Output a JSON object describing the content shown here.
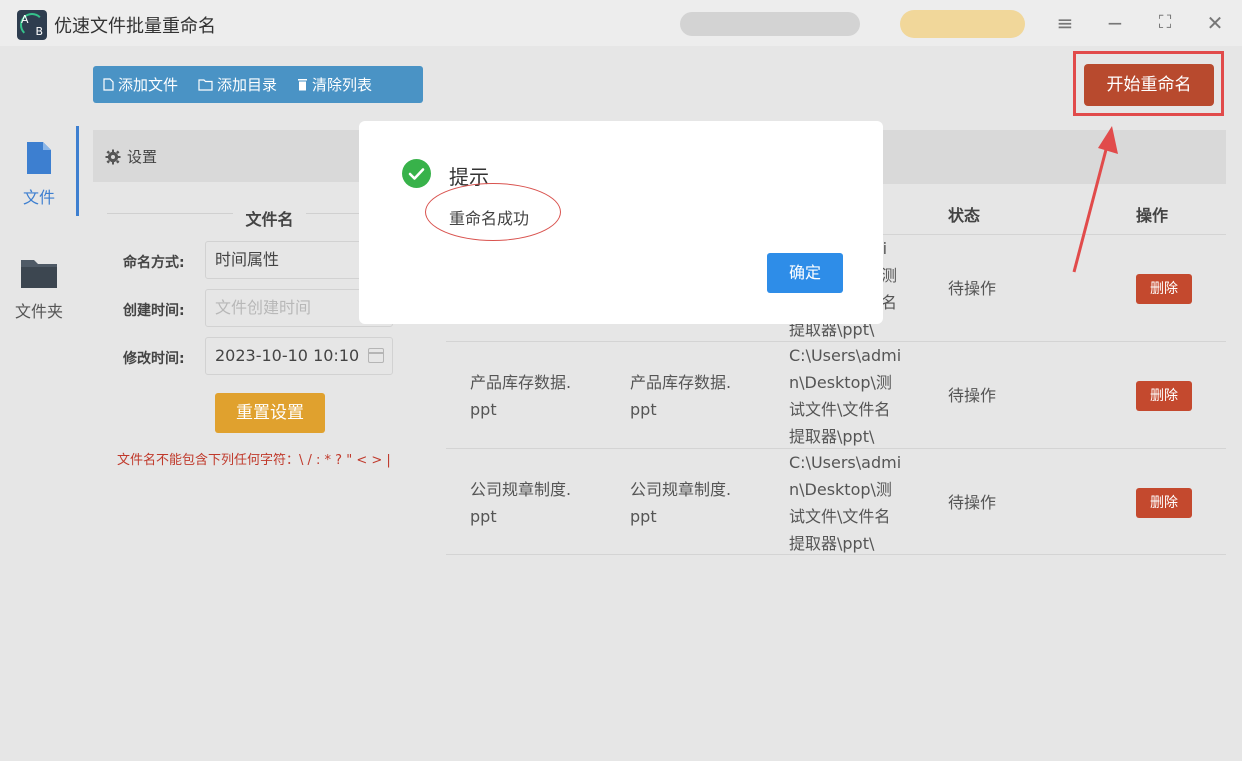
{
  "app": {
    "title": "优速文件批量重命名",
    "logo_a": "A",
    "logo_b": "B"
  },
  "window_controls": {
    "menu": "≡",
    "minimize": "−",
    "maximize": "⛶",
    "close": "✕"
  },
  "nav": {
    "items": [
      {
        "label": "文件",
        "icon": "file-icon",
        "active": true
      },
      {
        "label": "文件夹",
        "icon": "folder-icon",
        "active": false
      }
    ]
  },
  "toolbar": {
    "add_file": "添加文件",
    "add_dir": "添加目录",
    "clear_list": "清除列表",
    "start_rename": "开始重命名"
  },
  "settings": {
    "header": "设置",
    "section_title": "文件名",
    "fields": {
      "mode_label": "命名方式:",
      "mode_value": "时间属性",
      "created_label": "创建时间:",
      "created_placeholder": "文件创建时间",
      "modified_label": "修改时间:",
      "modified_value": "2023-10-10 10:10"
    },
    "reset_button": "重置设置",
    "warning": "文件名不能包含下列任何字符：\\ / : * ? \" < > |"
  },
  "table": {
    "columns": [
      "状态",
      "操作"
    ],
    "rows": [
      {
        "name_line1": "",
        "name_line2": "",
        "new_line1": "",
        "new_line2": "",
        "path_lines": [
          "mi",
          "测",
          "名",
          "提取器\\ppt\\"
        ],
        "status": "待操作",
        "action": "删除"
      },
      {
        "name_line1": "产品库存数据.",
        "name_line2": "ppt",
        "new_line1": "产品库存数据.",
        "new_line2": "ppt",
        "path_lines": [
          "C:\\Users\\admi",
          "n\\Desktop\\测",
          "试文件\\文件名",
          "提取器\\ppt\\"
        ],
        "status": "待操作",
        "action": "删除"
      },
      {
        "name_line1": "公司规章制度.",
        "name_line2": "ppt",
        "new_line1": "公司规章制度.",
        "new_line2": "ppt",
        "path_lines": [
          "C:\\Users\\admi",
          "n\\Desktop\\测",
          "试文件\\文件名",
          "提取器\\ppt\\"
        ],
        "status": "待操作",
        "action": "删除"
      }
    ]
  },
  "dialog": {
    "title": "提示",
    "message": "重命名成功",
    "ok_button": "确定"
  },
  "colors": {
    "accent_blue": "#2e8de8",
    "toolbar_blue": "#4a93c5",
    "start_button": "#b84a2e",
    "delete_button": "#c4492e",
    "reset_button": "#e0a12e",
    "success_green": "#38b24a",
    "annotation_red": "#e14b4b"
  }
}
